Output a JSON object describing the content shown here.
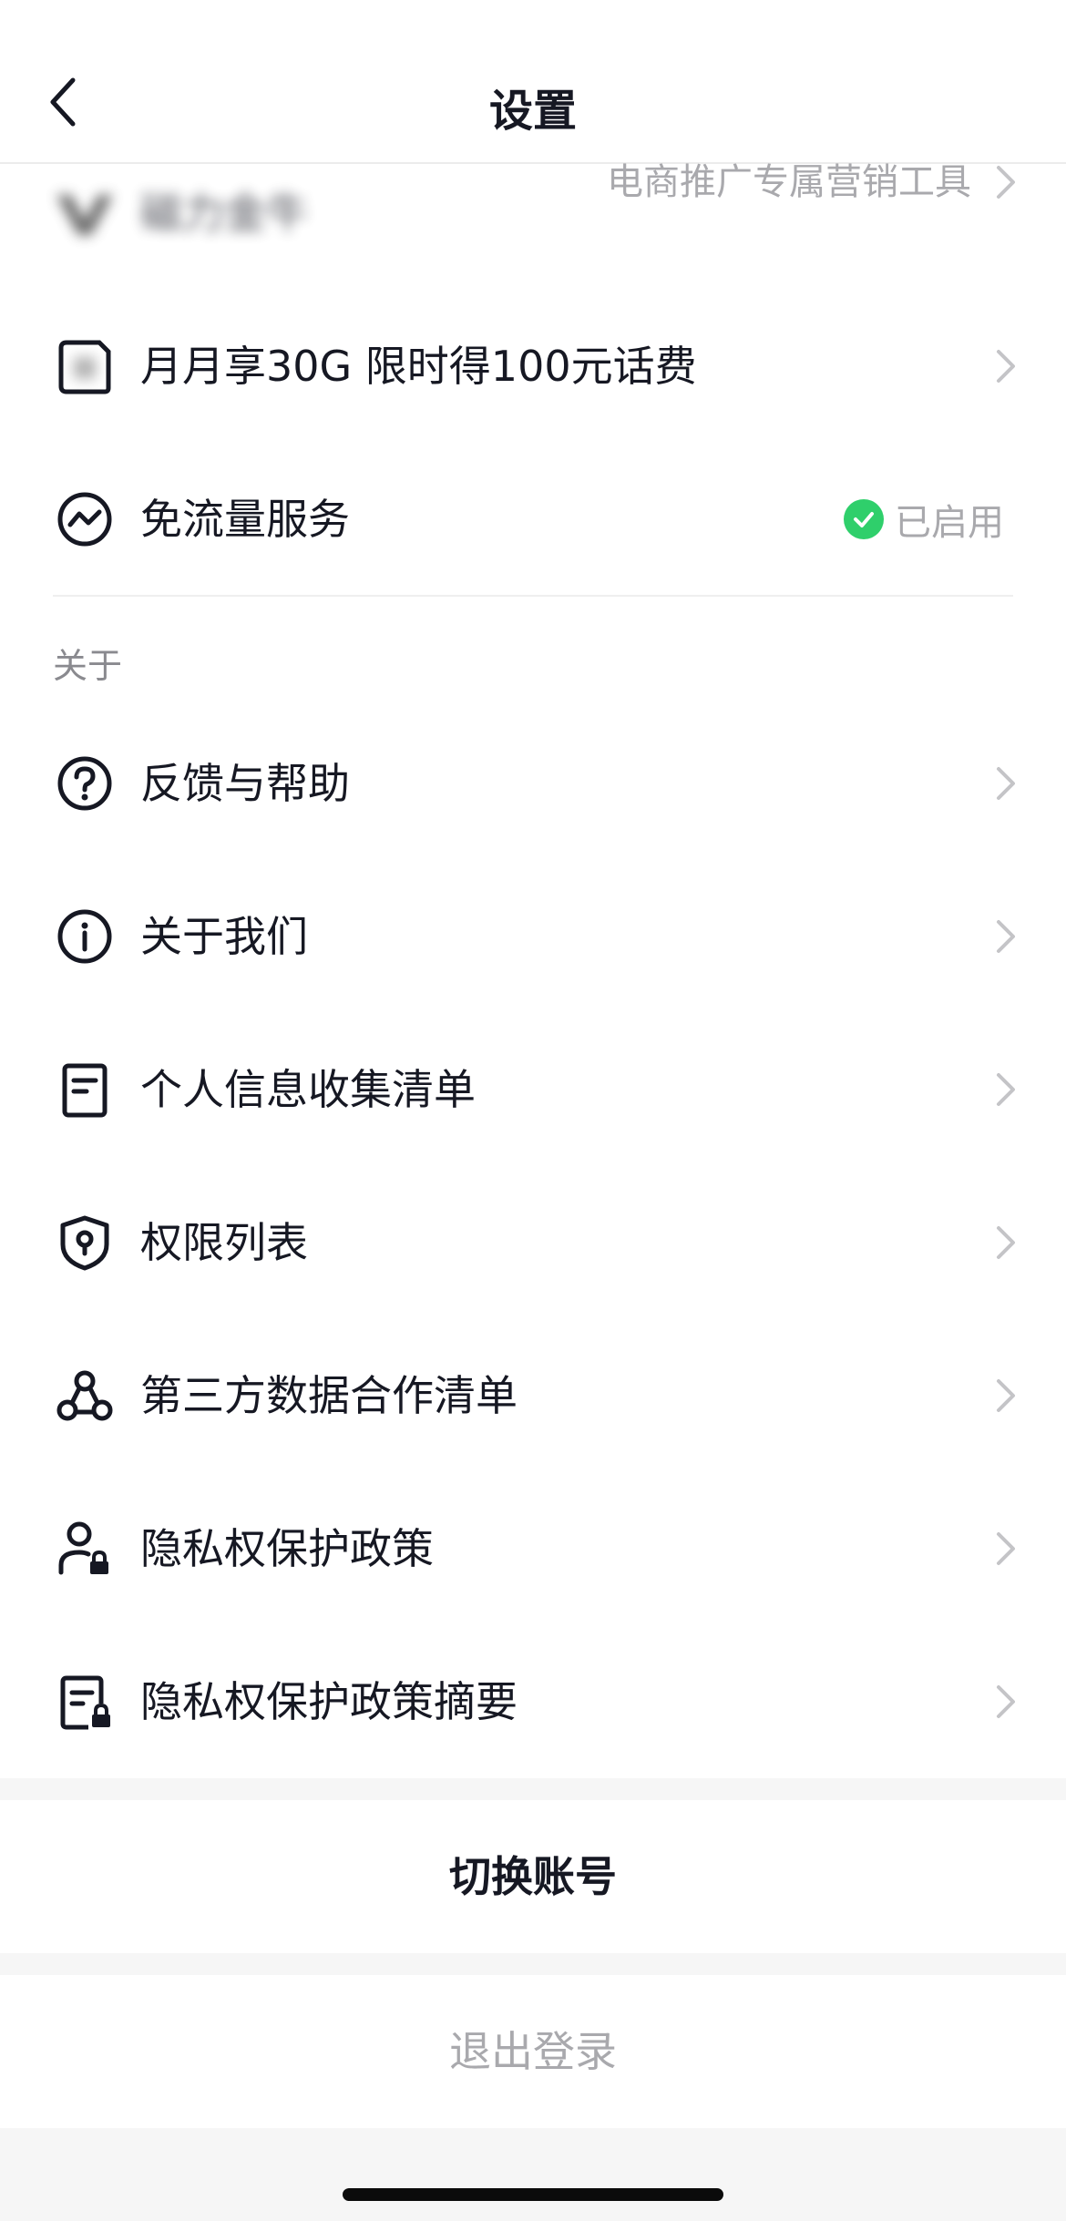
{
  "nav": {
    "title": "设置",
    "back_icon": "chevron-left-icon"
  },
  "rows_top": [
    {
      "name": "magic-star",
      "label": "磁力金牛",
      "right_text": "电商推广专属营销工具",
      "icon": "brand-logo-icon",
      "blurred": true
    },
    {
      "name": "data-plan",
      "label": "月月享30G 限时得100元话费",
      "icon": "sim-card-icon"
    },
    {
      "name": "free-traffic",
      "label": "免流量服务",
      "status_text": "已启用",
      "status_color": "#2fcf6b",
      "icon": "traffic-icon"
    }
  ],
  "about": {
    "section_title": "关于",
    "items": [
      {
        "label": "反馈与帮助",
        "icon": "help-circle-icon"
      },
      {
        "label": "关于我们",
        "icon": "info-circle-icon"
      },
      {
        "label": "个人信息收集清单",
        "icon": "document-list-icon"
      },
      {
        "label": "权限列表",
        "icon": "shield-lock-icon"
      },
      {
        "label": "第三方数据合作清单",
        "icon": "network-nodes-icon"
      },
      {
        "label": "隐私权保护政策",
        "icon": "user-lock-icon"
      },
      {
        "label": "隐私权保护政策摘要",
        "icon": "document-lock-icon"
      }
    ]
  },
  "actions": {
    "switch_account": "切换账号",
    "logout": "退出登录"
  },
  "colors": {
    "text_primary": "#161823",
    "text_secondary": "#a9a9ad",
    "success": "#2fcf6b",
    "band": "#f6f6f6"
  }
}
